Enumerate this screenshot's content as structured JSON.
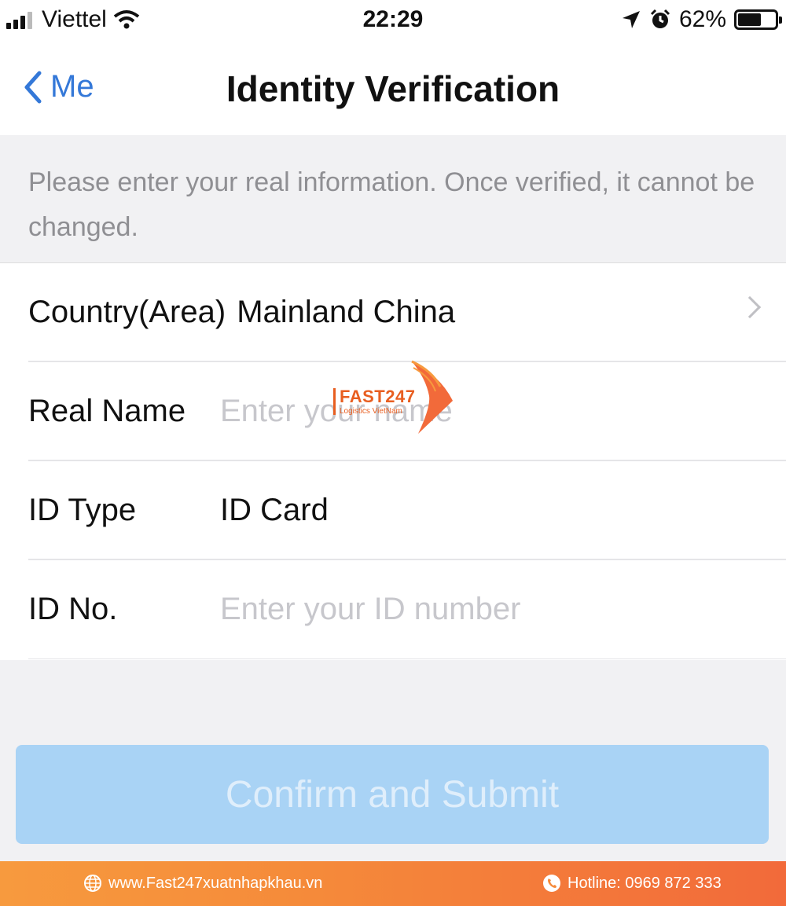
{
  "status_bar": {
    "carrier": "Viettel",
    "time": "22:29",
    "battery": "62%",
    "battery_level": 0.62
  },
  "nav": {
    "back_label": "Me",
    "title": "Identity Verification"
  },
  "notice": {
    "text": "Please enter your real information. Once verified, it cannot be changed."
  },
  "form": {
    "country": {
      "label": "Country(Area)",
      "value": "Mainland China"
    },
    "real_name": {
      "label": "Real Name",
      "placeholder": "Enter your name"
    },
    "id_type": {
      "label": "ID Type",
      "value": "ID Card"
    },
    "id_no": {
      "label": "ID No.",
      "placeholder": "Enter your ID number"
    }
  },
  "submit": {
    "label": "Confirm and Submit"
  },
  "watermark": {
    "brand": "FAST247",
    "tagline": "Logistics VietNam"
  },
  "footer": {
    "website": "www.Fast247xuatnhapkhau.vn",
    "hotline": "Hotline: 0969 872 333"
  },
  "colors": {
    "accent": "#3478d8",
    "button_disabled": "#a9d3f5",
    "footer": "#f58a3a"
  },
  "icons": [
    "signal-icon",
    "wifi-icon",
    "location-arrow-icon",
    "alarm-icon",
    "battery-icon",
    "back-chevron-icon",
    "chevron-right-icon",
    "globe-icon",
    "phone-icon"
  ]
}
